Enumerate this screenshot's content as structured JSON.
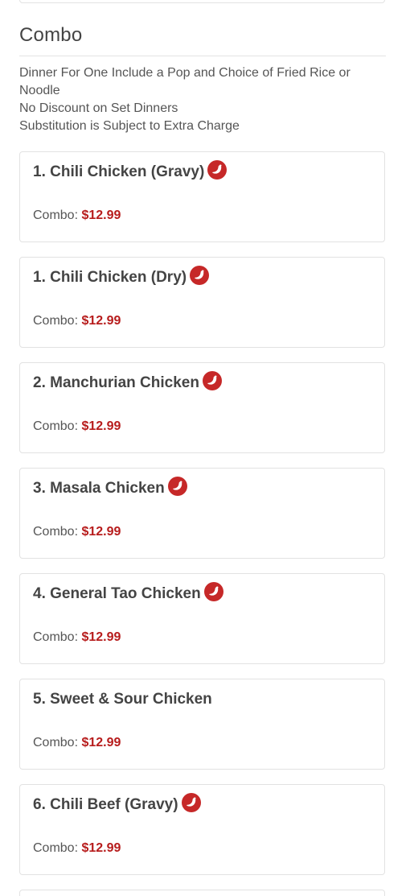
{
  "section": {
    "title": "Combo",
    "description": [
      "Dinner For One Include a Pop and Choice of Fried Rice or Noodle",
      "No Discount on Set Dinners",
      "Substitution is Subject to Extra Charge"
    ]
  },
  "items": [
    {
      "name": "1. Chili Chicken (Gravy)",
      "spicy": true,
      "price_label": "Combo:",
      "price": "$12.99"
    },
    {
      "name": "1. Chili Chicken (Dry)",
      "spicy": true,
      "price_label": "Combo:",
      "price": "$12.99"
    },
    {
      "name": "2. Manchurian Chicken",
      "spicy": true,
      "price_label": "Combo:",
      "price": "$12.99"
    },
    {
      "name": "3. Masala Chicken",
      "spicy": true,
      "price_label": "Combo:",
      "price": "$12.99"
    },
    {
      "name": "4. General Tao Chicken",
      "spicy": true,
      "price_label": "Combo:",
      "price": "$12.99"
    },
    {
      "name": "5. Sweet & Sour Chicken",
      "spicy": false,
      "price_label": "Combo:",
      "price": "$12.99"
    },
    {
      "name": "6. Chili Beef (Gravy)",
      "spicy": true,
      "price_label": "Combo:",
      "price": "$12.99"
    }
  ],
  "icons": {
    "spicy": "chili-pepper-icon"
  },
  "colors": {
    "price": "#b71c1c",
    "spicy_icon": "#c62828",
    "card_border": "#e2e2e2"
  }
}
